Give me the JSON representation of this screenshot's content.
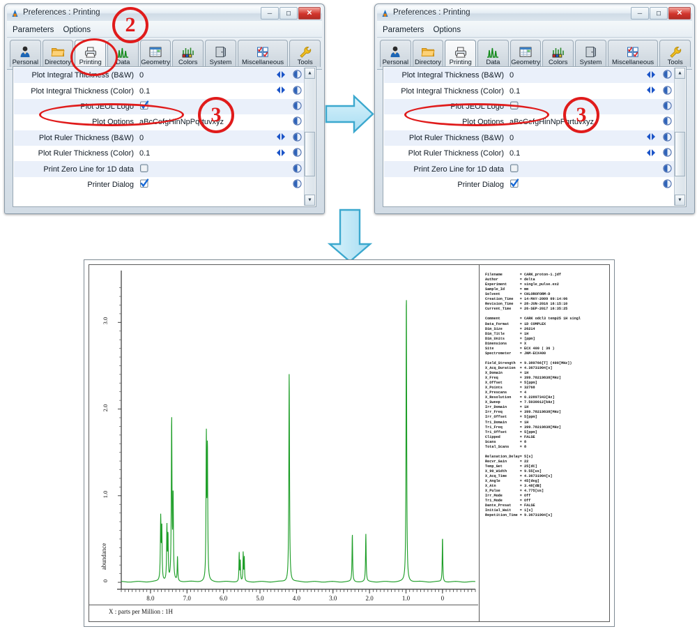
{
  "windows": [
    {
      "id": "left",
      "title": "Preferences : Printing",
      "menu": [
        "Parameters",
        "Options"
      ],
      "tabs": [
        {
          "label": "Personal",
          "icon": "person-icon",
          "selected": false
        },
        {
          "label": "Directory",
          "icon": "folder-icon",
          "selected": false
        },
        {
          "label": "Printing",
          "icon": "printer-icon",
          "selected": true
        },
        {
          "label": "Data",
          "icon": "spectrum-icon",
          "selected": false
        },
        {
          "label": "Geometry",
          "icon": "grid-icon",
          "selected": false
        },
        {
          "label": "Colors",
          "icon": "palette-icon",
          "selected": false
        },
        {
          "label": "System",
          "icon": "door-icon",
          "selected": false
        },
        {
          "label": "Miscellaneous",
          "icon": "checkboxes-icon",
          "selected": false
        },
        {
          "label": "Tools",
          "icon": "wrench-icon",
          "selected": false
        }
      ],
      "rows": [
        {
          "label": "Plot Integral Thickness (B&W)",
          "value": "0",
          "type": "text",
          "spinner": true
        },
        {
          "label": "Plot Integral Thickness (Color)",
          "value": "0.1",
          "type": "text",
          "spinner": true
        },
        {
          "label": "Plot JEOL Logo",
          "value": "",
          "type": "checkbox",
          "checked": true,
          "spinner": false
        },
        {
          "label": "Plot Options",
          "value": "aBcCefgHinNpPqrtuvxyz",
          "type": "text",
          "spinner": false
        },
        {
          "label": "Plot Ruler Thickness (B&W)",
          "value": "0",
          "type": "text",
          "spinner": true
        },
        {
          "label": "Plot Ruler Thickness (Color)",
          "value": "0.1",
          "type": "text",
          "spinner": true
        },
        {
          "label": "Print Zero Line for 1D data",
          "value": "",
          "type": "checkbox",
          "checked": false,
          "spinner": false
        },
        {
          "label": "Printer Dialog",
          "value": "",
          "type": "checkbox",
          "checked": true,
          "spinner": false
        }
      ],
      "window_buttons": [
        "minimize",
        "maximize",
        "close"
      ]
    },
    {
      "id": "right",
      "title": "Preferences : Printing",
      "menu": [
        "Parameters",
        "Options"
      ],
      "tabs": [
        {
          "label": "Personal",
          "icon": "person-icon",
          "selected": false
        },
        {
          "label": "Directory",
          "icon": "folder-icon",
          "selected": false
        },
        {
          "label": "Printing",
          "icon": "printer-icon",
          "selected": true
        },
        {
          "label": "Data",
          "icon": "spectrum-icon",
          "selected": false
        },
        {
          "label": "Geometry",
          "icon": "grid-icon",
          "selected": false
        },
        {
          "label": "Colors",
          "icon": "palette-icon",
          "selected": false
        },
        {
          "label": "System",
          "icon": "door-icon",
          "selected": false
        },
        {
          "label": "Miscellaneous",
          "icon": "checkboxes-icon",
          "selected": false
        },
        {
          "label": "Tools",
          "icon": "wrench-icon",
          "selected": false
        }
      ],
      "rows": [
        {
          "label": "Plot Integral Thickness (B&W)",
          "value": "0",
          "type": "text",
          "spinner": true
        },
        {
          "label": "Plot Integral Thickness (Color)",
          "value": "0.1",
          "type": "text",
          "spinner": true
        },
        {
          "label": "Plot JEOL Logo",
          "value": "",
          "type": "checkbox",
          "checked": false,
          "spinner": false
        },
        {
          "label": "Plot Options",
          "value": "aBcCefgHinNpPqrtuvxyz",
          "type": "text",
          "spinner": false
        },
        {
          "label": "Plot Ruler Thickness (B&W)",
          "value": "0",
          "type": "text",
          "spinner": true
        },
        {
          "label": "Plot Ruler Thickness (Color)",
          "value": "0.1",
          "type": "text",
          "spinner": true
        },
        {
          "label": "Print Zero Line for 1D data",
          "value": "",
          "type": "checkbox",
          "checked": false,
          "spinner": false
        },
        {
          "label": "Printer Dialog",
          "value": "",
          "type": "checkbox",
          "checked": true,
          "spinner": false
        }
      ],
      "window_buttons": [
        "minimize",
        "maximize",
        "close"
      ]
    }
  ],
  "annotations": {
    "step2": "2",
    "step3_left": "3",
    "step3_right": "3",
    "accent_color": "#e01b1b",
    "arrow_color": "#b8e6f7"
  },
  "chart_data": {
    "type": "line",
    "title": "",
    "xlabel": "X : parts per Million : 1H",
    "ylabel": "abundance",
    "xlim": [
      8.8,
      -0.9
    ],
    "ylim": [
      -0.08,
      3.55
    ],
    "xticks": [
      "8.0",
      "7.0",
      "6.0",
      "5.0",
      "4.0",
      "3.0",
      "2.0",
      "1.0",
      "0"
    ],
    "xtick_values": [
      8.0,
      7.0,
      6.0,
      5.0,
      4.0,
      3.0,
      2.0,
      1.0,
      0
    ],
    "yticks": [
      "0",
      "1.0",
      "2.0",
      "3.0"
    ],
    "ytick_values": [
      0,
      1.0,
      2.0,
      3.0
    ],
    "grid": false,
    "legend": false,
    "line_color": "#1e9e28",
    "peaks": [
      {
        "ppm": 7.72,
        "height": 0.72,
        "width": 0.022
      },
      {
        "ppm": 7.69,
        "height": 0.6,
        "width": 0.02
      },
      {
        "ppm": 7.55,
        "height": 0.62,
        "width": 0.02
      },
      {
        "ppm": 7.52,
        "height": 0.5,
        "width": 0.018
      },
      {
        "ppm": 7.42,
        "height": 1.86,
        "width": 0.022
      },
      {
        "ppm": 7.38,
        "height": 0.95,
        "width": 0.02
      },
      {
        "ppm": 7.26,
        "height": 0.28,
        "width": 0.018
      },
      {
        "ppm": 6.47,
        "height": 1.62,
        "width": 0.02
      },
      {
        "ppm": 6.44,
        "height": 1.5,
        "width": 0.02
      },
      {
        "ppm": 5.57,
        "height": 0.33,
        "width": 0.016
      },
      {
        "ppm": 5.54,
        "height": 0.24,
        "width": 0.016
      },
      {
        "ppm": 5.46,
        "height": 0.33,
        "width": 0.016
      },
      {
        "ppm": 5.43,
        "height": 0.27,
        "width": 0.016
      },
      {
        "ppm": 4.2,
        "height": 2.42,
        "width": 0.022
      },
      {
        "ppm": 2.47,
        "height": 0.55,
        "width": 0.02
      },
      {
        "ppm": 2.1,
        "height": 0.55,
        "width": 0.02
      },
      {
        "ppm": 0.99,
        "height": 3.38,
        "width": 0.02
      },
      {
        "ppm": 0.0,
        "height": 0.52,
        "width": 0.018
      }
    ]
  },
  "metadata_blocks": [
    [
      [
        "Filename",
        "CARK_proton-1.jdf"
      ],
      [
        "Author",
        "delta"
      ],
      [
        "Experiment",
        "single_pulse.ex2"
      ],
      [
        "Sample_Id",
        "mm"
      ],
      [
        "Solvent",
        "CHLOROFORM-D"
      ],
      [
        "Creation_Time",
        "14-MAY-2009 09:14:06"
      ],
      [
        "Revision_Time",
        "28-JUN-2016 16:15:10"
      ],
      [
        "Current_Time",
        "26-SEP-2017 16:35:25"
      ]
    ],
    [
      [
        "Comment",
        "CARK odcl3 temp25 1H singl"
      ],
      [
        "Data_Format",
        "1D COMPLEX"
      ],
      [
        "Dim_Size",
        "26214"
      ],
      [
        "Dim_Title",
        "1H"
      ],
      [
        "Dim_Units",
        "[ppm]"
      ],
      [
        "Dimensions",
        "X"
      ],
      [
        "Site",
        "ECX 400 ( 36 )"
      ],
      [
        "Spectrometer",
        "JNM-ECX400"
      ]
    ],
    [
      [
        "Field_Strength",
        "9.389766[T] (400[MHz])"
      ],
      [
        "X_Acq_Duration",
        "4.36731904[s]"
      ],
      [
        "X_Domain",
        "1H"
      ],
      [
        "X_Freq",
        "399.78219838[MHz]"
      ],
      [
        "X_Offset",
        "5[ppm]"
      ],
      [
        "X_Points",
        "32768"
      ],
      [
        "X_Prescans",
        "4"
      ],
      [
        "X_Resolution",
        "0.22897343[Hz]"
      ],
      [
        "X_Sweep",
        "7.5030012[kHz]"
      ],
      [
        "Irr_Domain",
        "1H"
      ],
      [
        "Irr_Freq",
        "399.78219838[MHz]"
      ],
      [
        "Irr_Offset",
        "5[ppm]"
      ],
      [
        "Tri_Domain",
        "1H"
      ],
      [
        "Tri_Freq",
        "399.78219838[MHz]"
      ],
      [
        "Tri_Offset",
        "5[ppm]"
      ],
      [
        "Clipped",
        "FALSE"
      ],
      [
        "Scans",
        "8"
      ],
      [
        "Total_Scans",
        "8"
      ]
    ],
    [
      [
        "Relaxation_Delay",
        "5[s]"
      ],
      [
        "Recvr_Gain",
        "22"
      ],
      [
        "Temp_Get",
        "25[dC]"
      ],
      [
        "X_90_Width",
        "9.55[us]"
      ],
      [
        "X_Acq_Time",
        "4.36731904[s]"
      ],
      [
        "X_Angle",
        "45[deg]"
      ],
      [
        "X_Atn",
        "3.48[dB]"
      ],
      [
        "X_Pulse",
        "4.775[us]"
      ],
      [
        "Irr_Mode",
        "Off"
      ],
      [
        "Tri_Mode",
        "Off"
      ],
      [
        "Dante_Presat",
        "FALSE"
      ],
      [
        "Initial_Wait",
        "1[s]"
      ],
      [
        "Repetition_Time",
        "9.36731904[s]"
      ]
    ]
  ]
}
